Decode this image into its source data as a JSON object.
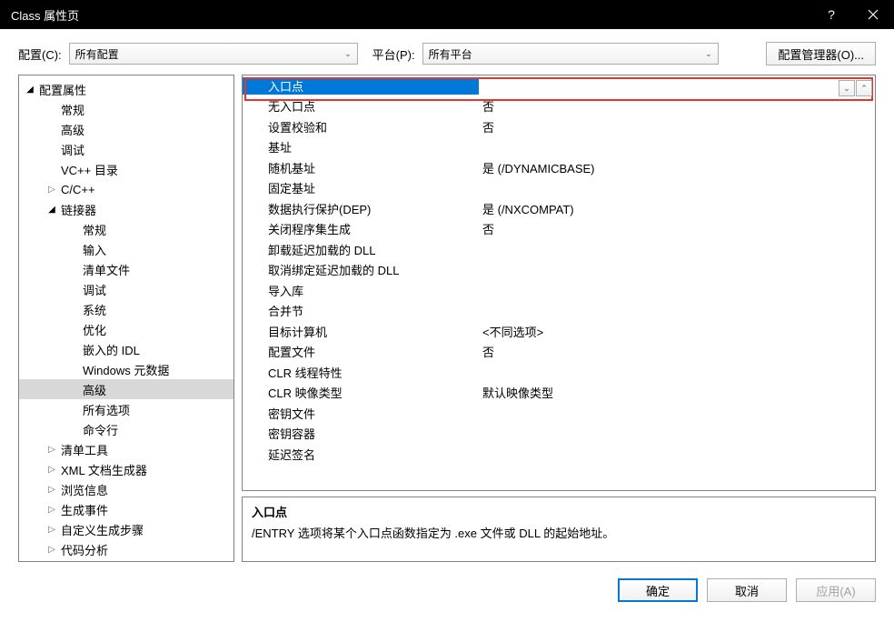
{
  "title": "Class 属性页",
  "toolbar": {
    "config_label": "配置(C):",
    "config_value": "所有配置",
    "platform_label": "平台(P):",
    "platform_value": "所有平台",
    "config_mgr": "配置管理器(O)..."
  },
  "tree": [
    {
      "label": "配置属性",
      "lvl": 0,
      "open": true
    },
    {
      "label": "常规",
      "lvl": 1
    },
    {
      "label": "高级",
      "lvl": 1
    },
    {
      "label": "调试",
      "lvl": 1
    },
    {
      "label": "VC++ 目录",
      "lvl": 1
    },
    {
      "label": "C/C++",
      "lvl": 1,
      "open": false,
      "toggle": true
    },
    {
      "label": "链接器",
      "lvl": 1,
      "open": true,
      "toggle": true
    },
    {
      "label": "常规",
      "lvl": 2
    },
    {
      "label": "输入",
      "lvl": 2
    },
    {
      "label": "清单文件",
      "lvl": 2
    },
    {
      "label": "调试",
      "lvl": 2
    },
    {
      "label": "系统",
      "lvl": 2
    },
    {
      "label": "优化",
      "lvl": 2
    },
    {
      "label": "嵌入的 IDL",
      "lvl": 2
    },
    {
      "label": "Windows 元数据",
      "lvl": 2
    },
    {
      "label": "高级",
      "lvl": 2,
      "selected": true
    },
    {
      "label": "所有选项",
      "lvl": 2
    },
    {
      "label": "命令行",
      "lvl": 2
    },
    {
      "label": "清单工具",
      "lvl": 1,
      "open": false,
      "toggle": true
    },
    {
      "label": "XML 文档生成器",
      "lvl": 1,
      "open": false,
      "toggle": true
    },
    {
      "label": "浏览信息",
      "lvl": 1,
      "open": false,
      "toggle": true
    },
    {
      "label": "生成事件",
      "lvl": 1,
      "open": false,
      "toggle": true
    },
    {
      "label": "自定义生成步骤",
      "lvl": 1,
      "open": false,
      "toggle": true
    },
    {
      "label": "代码分析",
      "lvl": 1,
      "open": false,
      "toggle": true
    }
  ],
  "grid": [
    {
      "name": "入口点",
      "value": "",
      "selected": true
    },
    {
      "name": "无入口点",
      "value": "否"
    },
    {
      "name": "设置校验和",
      "value": "否"
    },
    {
      "name": "基址",
      "value": ""
    },
    {
      "name": "随机基址",
      "value": "是 (/DYNAMICBASE)"
    },
    {
      "name": "固定基址",
      "value": ""
    },
    {
      "name": "数据执行保护(DEP)",
      "value": "是 (/NXCOMPAT)"
    },
    {
      "name": "关闭程序集生成",
      "value": "否"
    },
    {
      "name": "卸载延迟加载的 DLL",
      "value": ""
    },
    {
      "name": "取消绑定延迟加载的 DLL",
      "value": ""
    },
    {
      "name": "导入库",
      "value": ""
    },
    {
      "name": "合并节",
      "value": ""
    },
    {
      "name": "目标计算机",
      "value": "<不同选项>"
    },
    {
      "name": "配置文件",
      "value": "否"
    },
    {
      "name": "CLR 线程特性",
      "value": ""
    },
    {
      "name": "CLR 映像类型",
      "value": "默认映像类型"
    },
    {
      "name": "密钥文件",
      "value": ""
    },
    {
      "name": "密钥容器",
      "value": ""
    },
    {
      "name": "延迟签名",
      "value": ""
    }
  ],
  "desc": {
    "title": "入口点",
    "body": "/ENTRY 选项将某个入口点函数指定为 .exe 文件或 DLL 的起始地址。"
  },
  "buttons": {
    "ok": "确定",
    "cancel": "取消",
    "apply": "应用(A)"
  }
}
